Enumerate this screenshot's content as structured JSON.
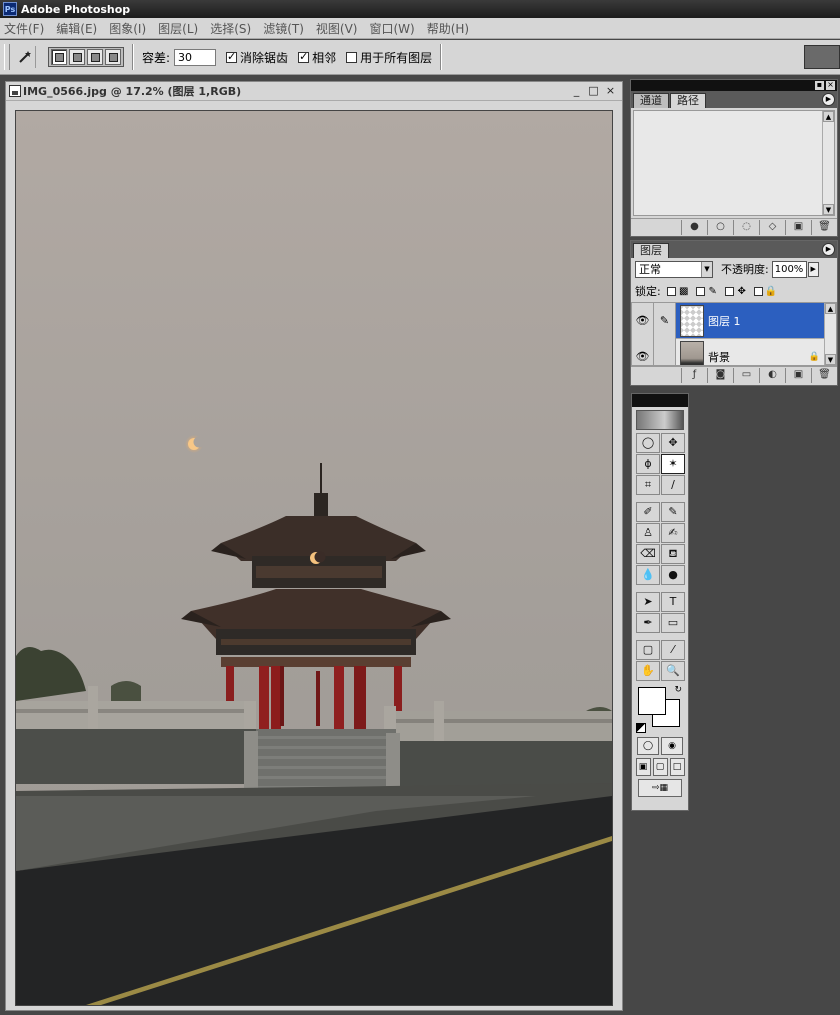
{
  "app": {
    "title": "Adobe Photoshop",
    "logo": "Ps"
  },
  "menu": [
    "文件(F)",
    "编辑(E)",
    "图象(I)",
    "图层(L)",
    "选择(S)",
    "滤镜(T)",
    "视图(V)",
    "窗口(W)",
    "帮助(H)"
  ],
  "options": {
    "tolerance_label": "容差:",
    "tolerance_value": "30",
    "antialias_label": "消除锯齿",
    "antialias_checked": true,
    "contiguous_label": "相邻",
    "contiguous_checked": true,
    "all_layers_label": "用于所有图层",
    "all_layers_checked": false
  },
  "document": {
    "title": "IMG_0566.jpg @ 17.2% (图层 1,RGB)",
    "window_buttons": [
      "_",
      "□",
      "×"
    ]
  },
  "channels_panel": {
    "tabs": [
      "通道",
      "路径"
    ],
    "active_tab": 1,
    "footer_icons": [
      "fill-path-icon",
      "stroke-path-icon",
      "load-selection-icon",
      "make-work-path-icon",
      "new-path-icon",
      "trash-icon"
    ]
  },
  "layers_panel": {
    "tab": "图层",
    "blend_mode": "正常",
    "opacity_label": "不透明度:",
    "opacity_value": "100%",
    "lock_label": "锁定:",
    "layers": [
      {
        "name": "图层 1",
        "selected": true,
        "visible": true
      },
      {
        "name": "背景",
        "selected": false,
        "visible": true,
        "locked": true
      }
    ]
  },
  "toolbox": {
    "tools": [
      "marquee-tool",
      "move-tool",
      "lasso-tool",
      "magic-wand-tool",
      "crop-tool",
      "slice-tool",
      "healing-brush-tool",
      "brush-tool",
      "clone-stamp-tool",
      "history-brush-tool",
      "eraser-tool",
      "paint-bucket-tool",
      "blur-tool",
      "dodge-tool",
      "path-selection-tool",
      "type-tool",
      "pen-tool",
      "rectangle-tool",
      "notes-tool",
      "eyedropper-tool",
      "hand-tool",
      "zoom-tool"
    ],
    "active_tool": "magic-wand-tool",
    "foreground_color": "#ffffff",
    "background_color": "#ffffff"
  },
  "colors": {
    "selection": "#2c5fbf",
    "sky_top": "#b1a9a3",
    "sky_bottom": "#9d9893",
    "road": "#232425"
  }
}
